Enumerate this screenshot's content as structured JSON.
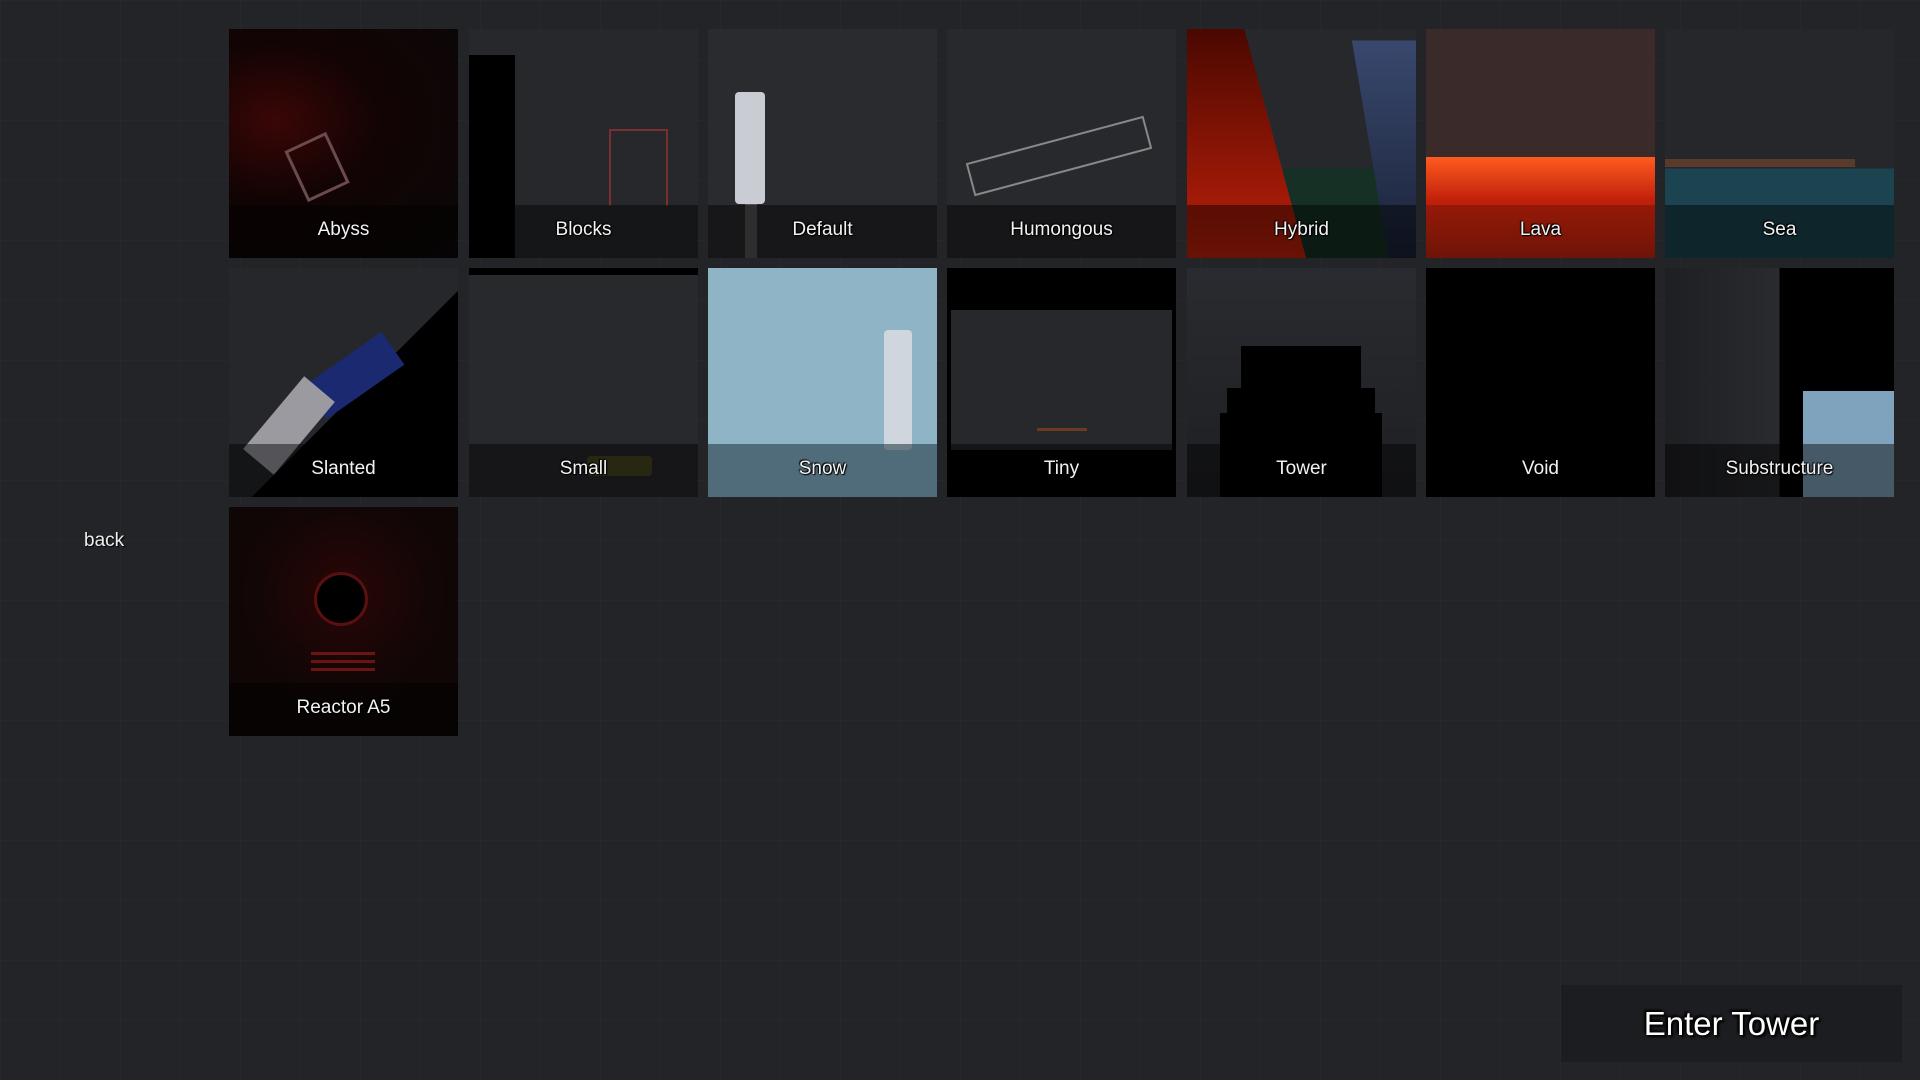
{
  "maps": [
    {
      "label": "Abyss"
    },
    {
      "label": "Blocks"
    },
    {
      "label": "Default"
    },
    {
      "label": "Humongous"
    },
    {
      "label": "Hybrid"
    },
    {
      "label": "Lava"
    },
    {
      "label": "Sea"
    },
    {
      "label": "Slanted"
    },
    {
      "label": "Small"
    },
    {
      "label": "Snow"
    },
    {
      "label": "Tiny"
    },
    {
      "label": "Tower"
    },
    {
      "label": "Void"
    },
    {
      "label": "Substructure"
    },
    {
      "label": "Reactor A5"
    }
  ],
  "nav": {
    "back_label": "back"
  },
  "action": {
    "enter_label": "Enter Tower"
  },
  "colors": {
    "background": "#232428",
    "button": "#1c1d20"
  }
}
